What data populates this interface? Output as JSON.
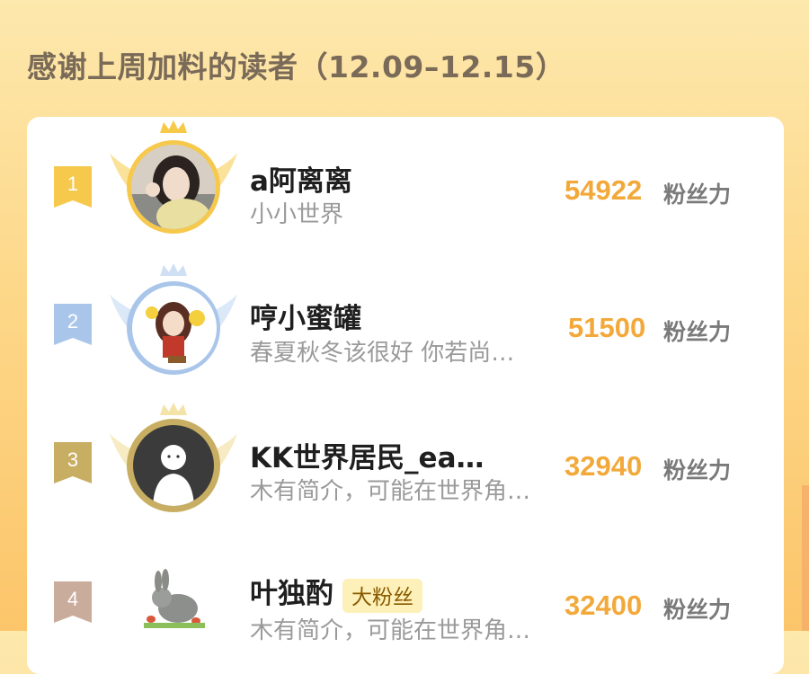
{
  "header": {
    "title": "感谢上周加料的读者（12.09–12.15）"
  },
  "readers": [
    {
      "rank": "1",
      "name": "a阿离离",
      "bio": "小小世界",
      "badge": "",
      "score": "54922",
      "unit": "粉丝力",
      "tier_color": "#f6c94c"
    },
    {
      "rank": "2",
      "name": "哼小蜜罐",
      "bio": "春夏秋冬该很好 你若尚…",
      "badge": "",
      "score": "51500",
      "unit": "粉丝力",
      "tier_color": "#a9c6ea"
    },
    {
      "rank": "3",
      "name": "KK世界居民_ea…",
      "bio": "木有简介，可能在世界角…",
      "badge": "",
      "score": "32940",
      "unit": "粉丝力",
      "tier_color": "#c8ae62"
    },
    {
      "rank": "4",
      "name": "叶独酌",
      "bio": "木有简介，可能在世界角…",
      "badge": "大粉丝",
      "score": "32400",
      "unit": "粉丝力",
      "tier_color": "#c9ac9c"
    }
  ]
}
